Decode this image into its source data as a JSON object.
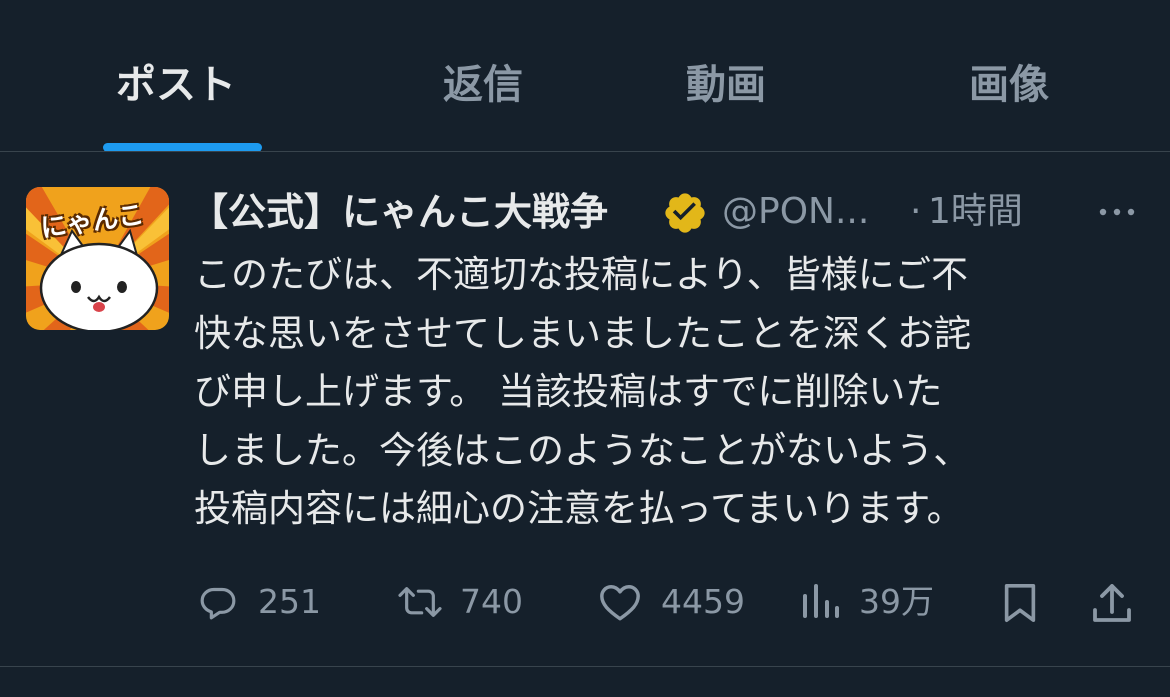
{
  "tabs": [
    {
      "label": "ポスト",
      "active": true
    },
    {
      "label": "返信",
      "active": false
    },
    {
      "label": "動画",
      "active": false
    },
    {
      "label": "画像",
      "active": false
    }
  ],
  "post": {
    "avatar_text": "にゃんこ",
    "display_name": "【公式】にゃんこ大戦争",
    "verified_badge_icon": "verified-gold-badge",
    "handle": "@PON...",
    "separator": "·",
    "timestamp": "1時間",
    "more_icon": "more-horizontal-icon",
    "text_lines": [
      "このたびは、不適切な投稿により、皆様にご不",
      "快な思いをさせてしまいましたことを深くお詫",
      "び申し上げます。 当該投稿はすでに削除いた",
      "しました。今後はこのようなことがないよう、",
      "投稿内容には細心の注意を払ってまいります。"
    ]
  },
  "actions": {
    "reply": {
      "icon": "reply-icon",
      "count": "251"
    },
    "repost": {
      "icon": "repost-icon",
      "count": "740"
    },
    "like": {
      "icon": "heart-icon",
      "count": "4459"
    },
    "views": {
      "icon": "views-icon",
      "count": "39万"
    },
    "bookmark": {
      "icon": "bookmark-icon"
    },
    "share": {
      "icon": "share-icon"
    }
  },
  "colors": {
    "background": "#15202b",
    "text_primary": "#e7e9ea",
    "text_secondary": "#8b98a5",
    "accent": "#1d9bf0",
    "divider": "#38444d",
    "verified_gold": "#e2b719"
  }
}
